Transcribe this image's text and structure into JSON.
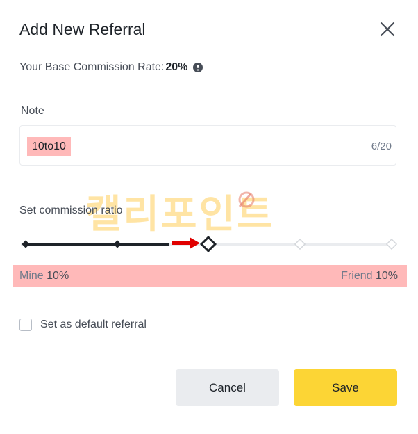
{
  "dialog": {
    "title": "Add New Referral",
    "close_icon": "close-icon"
  },
  "rate": {
    "label": "Your Base Commission Rate:",
    "value": "20%",
    "info_icon": "info-icon"
  },
  "note": {
    "label": "Note",
    "value": "10to10",
    "counter": "6/20"
  },
  "ratio": {
    "label": "Set commission ratio",
    "selected_step": 2,
    "step_count": 5,
    "mine_label": "Mine",
    "mine_value": "10%",
    "friend_label": "Friend",
    "friend_value": "10%"
  },
  "default_referral": {
    "label": "Set as default referral",
    "checked": false
  },
  "buttons": {
    "cancel": "Cancel",
    "save": "Save"
  },
  "watermark": "캘리포인트",
  "colors": {
    "accent": "#fcd535",
    "highlight": "#ffb9b9",
    "slider_active": "#1e2329",
    "slider_inactive": "#eaecef",
    "arrow": "#e00000",
    "cancel_bg": "#eaecef"
  }
}
